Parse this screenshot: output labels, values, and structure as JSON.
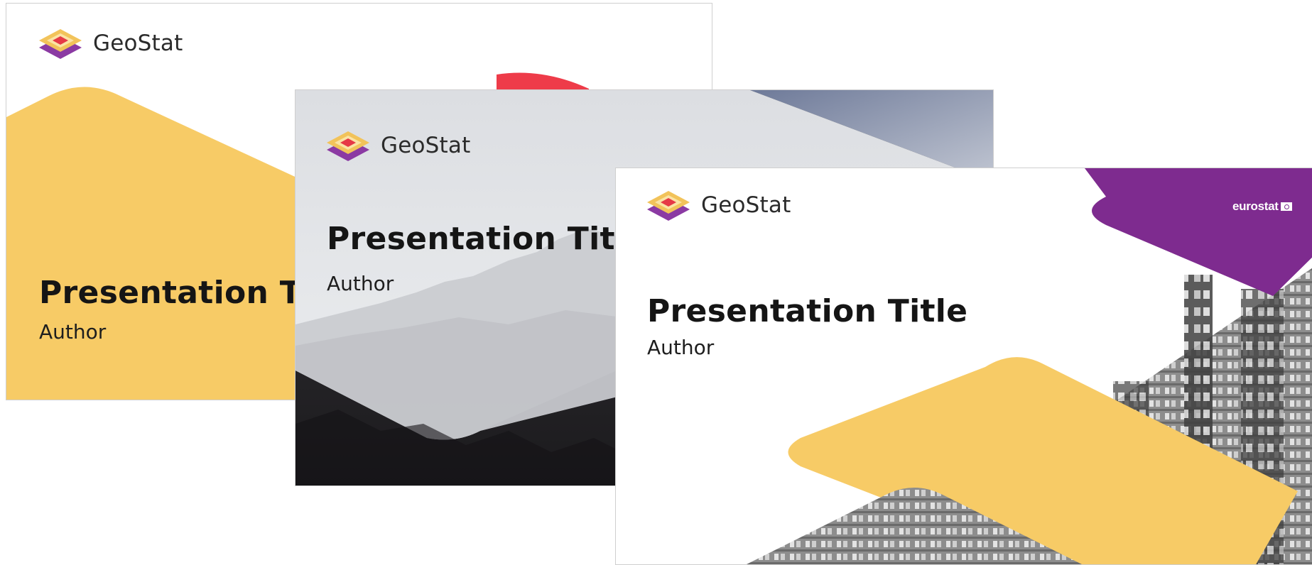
{
  "slides": [
    {
      "logo_text": "GeoStat",
      "title": "Presentation Title",
      "author": "Author"
    },
    {
      "logo_text": "GeoStat",
      "title": "Presentation Title",
      "author": "Author"
    },
    {
      "logo_text": "GeoStat",
      "title": "Presentation Title",
      "author": "Author",
      "partner_logo": "eurostat"
    }
  ],
  "colors": {
    "yellow": "#F7CB66",
    "red": "#EE3B49",
    "purple": "#7E2B8F",
    "logo_top": "#F2B84B",
    "logo_bottom": "#8B3AA3",
    "logo_center": "#E63946"
  }
}
